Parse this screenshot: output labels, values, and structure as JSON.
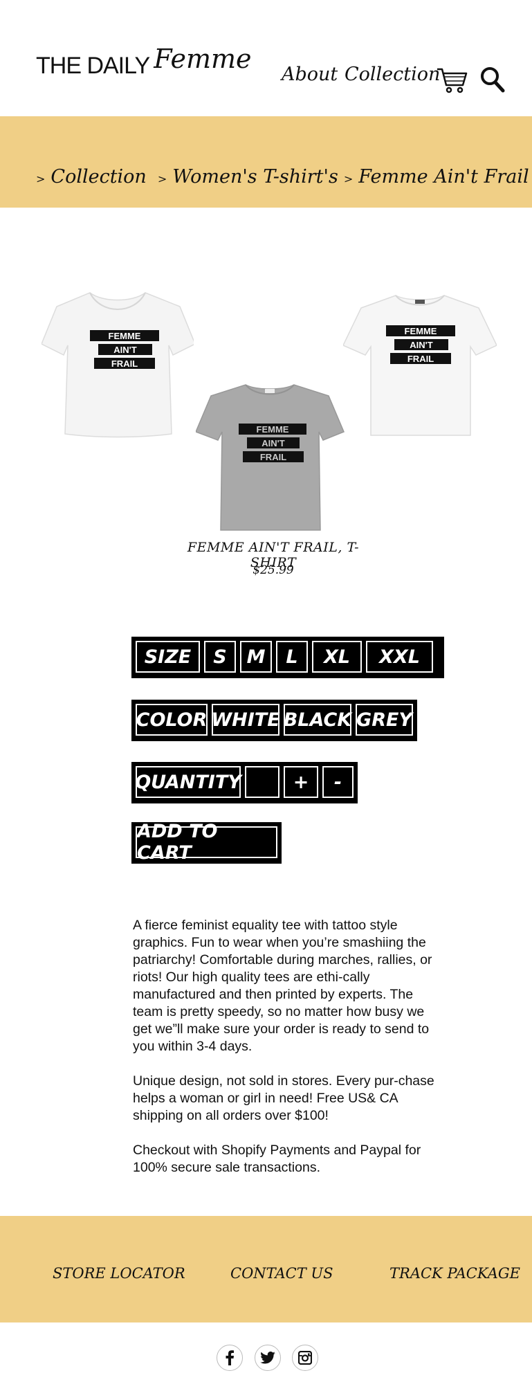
{
  "header": {
    "logo_daily": "THE DAILY",
    "logo_femme": "Femme",
    "nav": {
      "about": "About",
      "collection": "Collection"
    }
  },
  "breadcrumb": {
    "separator": ">",
    "items": [
      "Collection",
      "Women's T-shirt's",
      "Femme Ain't Frail"
    ]
  },
  "product": {
    "name": "FEMME AIN'T FRAIL, T-SHIRT",
    "price": "$25.99",
    "print_lines": [
      "FEMME",
      "AIN'T",
      "FRAIL"
    ],
    "tee_colors": {
      "white": "#f4f4f4",
      "grey": "#a9a9a9"
    }
  },
  "options": {
    "size": {
      "label": "SIZE",
      "values": [
        "S",
        "M",
        "L",
        "XL",
        "XXL"
      ]
    },
    "color": {
      "label": "COLOR",
      "values": [
        "WHITE",
        "BLACK",
        "GREY"
      ]
    },
    "quantity": {
      "label": "QUANTITY",
      "value": "",
      "plus": "+",
      "minus": "-"
    },
    "add_to_cart": "ADD TO CART"
  },
  "description": [
    "A fierce feminist equality tee with tattoo style graphics. Fun to wear when you’re smashiing the patriarchy! Comfortable during marches, rallies, or riots!  Our high quality tees are ethi-cally manufactured and then printed by experts. The team is pretty speedy, so no matter how busy we get we”ll make sure your order is ready to send to you within 3-4 days.",
    "Unique design, not sold in stores. Every pur-chase helps a woman or girl in need! Free US& CA shipping on all orders over $100!",
    "Checkout with Shopify Payments and Paypal for 100% secure sale transactions."
  ],
  "footer": {
    "links": [
      "STORE LOCATOR",
      "CONTACT US",
      "TRACK PACKAGE"
    ],
    "social": [
      "facebook-icon",
      "twitter-icon",
      "instagram-icon"
    ]
  },
  "colors": {
    "accent": "#f0cf86",
    "black": "#000000"
  }
}
